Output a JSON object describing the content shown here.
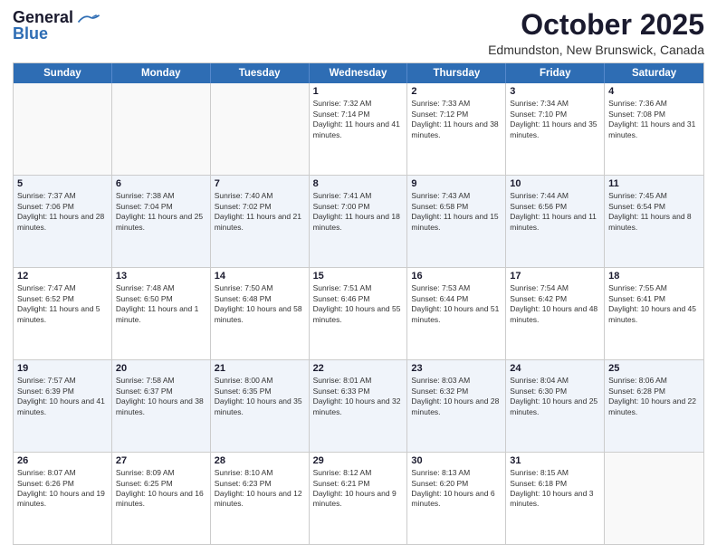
{
  "header": {
    "logo_line1": "General",
    "logo_line2": "Blue",
    "month": "October 2025",
    "location": "Edmundston, New Brunswick, Canada"
  },
  "days_of_week": [
    "Sunday",
    "Monday",
    "Tuesday",
    "Wednesday",
    "Thursday",
    "Friday",
    "Saturday"
  ],
  "weeks": [
    [
      {
        "day": "",
        "sunrise": "",
        "sunset": "",
        "daylight": ""
      },
      {
        "day": "",
        "sunrise": "",
        "sunset": "",
        "daylight": ""
      },
      {
        "day": "",
        "sunrise": "",
        "sunset": "",
        "daylight": ""
      },
      {
        "day": "1",
        "sunrise": "Sunrise: 7:32 AM",
        "sunset": "Sunset: 7:14 PM",
        "daylight": "Daylight: 11 hours and 41 minutes."
      },
      {
        "day": "2",
        "sunrise": "Sunrise: 7:33 AM",
        "sunset": "Sunset: 7:12 PM",
        "daylight": "Daylight: 11 hours and 38 minutes."
      },
      {
        "day": "3",
        "sunrise": "Sunrise: 7:34 AM",
        "sunset": "Sunset: 7:10 PM",
        "daylight": "Daylight: 11 hours and 35 minutes."
      },
      {
        "day": "4",
        "sunrise": "Sunrise: 7:36 AM",
        "sunset": "Sunset: 7:08 PM",
        "daylight": "Daylight: 11 hours and 31 minutes."
      }
    ],
    [
      {
        "day": "5",
        "sunrise": "Sunrise: 7:37 AM",
        "sunset": "Sunset: 7:06 PM",
        "daylight": "Daylight: 11 hours and 28 minutes."
      },
      {
        "day": "6",
        "sunrise": "Sunrise: 7:38 AM",
        "sunset": "Sunset: 7:04 PM",
        "daylight": "Daylight: 11 hours and 25 minutes."
      },
      {
        "day": "7",
        "sunrise": "Sunrise: 7:40 AM",
        "sunset": "Sunset: 7:02 PM",
        "daylight": "Daylight: 11 hours and 21 minutes."
      },
      {
        "day": "8",
        "sunrise": "Sunrise: 7:41 AM",
        "sunset": "Sunset: 7:00 PM",
        "daylight": "Daylight: 11 hours and 18 minutes."
      },
      {
        "day": "9",
        "sunrise": "Sunrise: 7:43 AM",
        "sunset": "Sunset: 6:58 PM",
        "daylight": "Daylight: 11 hours and 15 minutes."
      },
      {
        "day": "10",
        "sunrise": "Sunrise: 7:44 AM",
        "sunset": "Sunset: 6:56 PM",
        "daylight": "Daylight: 11 hours and 11 minutes."
      },
      {
        "day": "11",
        "sunrise": "Sunrise: 7:45 AM",
        "sunset": "Sunset: 6:54 PM",
        "daylight": "Daylight: 11 hours and 8 minutes."
      }
    ],
    [
      {
        "day": "12",
        "sunrise": "Sunrise: 7:47 AM",
        "sunset": "Sunset: 6:52 PM",
        "daylight": "Daylight: 11 hours and 5 minutes."
      },
      {
        "day": "13",
        "sunrise": "Sunrise: 7:48 AM",
        "sunset": "Sunset: 6:50 PM",
        "daylight": "Daylight: 11 hours and 1 minute."
      },
      {
        "day": "14",
        "sunrise": "Sunrise: 7:50 AM",
        "sunset": "Sunset: 6:48 PM",
        "daylight": "Daylight: 10 hours and 58 minutes."
      },
      {
        "day": "15",
        "sunrise": "Sunrise: 7:51 AM",
        "sunset": "Sunset: 6:46 PM",
        "daylight": "Daylight: 10 hours and 55 minutes."
      },
      {
        "day": "16",
        "sunrise": "Sunrise: 7:53 AM",
        "sunset": "Sunset: 6:44 PM",
        "daylight": "Daylight: 10 hours and 51 minutes."
      },
      {
        "day": "17",
        "sunrise": "Sunrise: 7:54 AM",
        "sunset": "Sunset: 6:42 PM",
        "daylight": "Daylight: 10 hours and 48 minutes."
      },
      {
        "day": "18",
        "sunrise": "Sunrise: 7:55 AM",
        "sunset": "Sunset: 6:41 PM",
        "daylight": "Daylight: 10 hours and 45 minutes."
      }
    ],
    [
      {
        "day": "19",
        "sunrise": "Sunrise: 7:57 AM",
        "sunset": "Sunset: 6:39 PM",
        "daylight": "Daylight: 10 hours and 41 minutes."
      },
      {
        "day": "20",
        "sunrise": "Sunrise: 7:58 AM",
        "sunset": "Sunset: 6:37 PM",
        "daylight": "Daylight: 10 hours and 38 minutes."
      },
      {
        "day": "21",
        "sunrise": "Sunrise: 8:00 AM",
        "sunset": "Sunset: 6:35 PM",
        "daylight": "Daylight: 10 hours and 35 minutes."
      },
      {
        "day": "22",
        "sunrise": "Sunrise: 8:01 AM",
        "sunset": "Sunset: 6:33 PM",
        "daylight": "Daylight: 10 hours and 32 minutes."
      },
      {
        "day": "23",
        "sunrise": "Sunrise: 8:03 AM",
        "sunset": "Sunset: 6:32 PM",
        "daylight": "Daylight: 10 hours and 28 minutes."
      },
      {
        "day": "24",
        "sunrise": "Sunrise: 8:04 AM",
        "sunset": "Sunset: 6:30 PM",
        "daylight": "Daylight: 10 hours and 25 minutes."
      },
      {
        "day": "25",
        "sunrise": "Sunrise: 8:06 AM",
        "sunset": "Sunset: 6:28 PM",
        "daylight": "Daylight: 10 hours and 22 minutes."
      }
    ],
    [
      {
        "day": "26",
        "sunrise": "Sunrise: 8:07 AM",
        "sunset": "Sunset: 6:26 PM",
        "daylight": "Daylight: 10 hours and 19 minutes."
      },
      {
        "day": "27",
        "sunrise": "Sunrise: 8:09 AM",
        "sunset": "Sunset: 6:25 PM",
        "daylight": "Daylight: 10 hours and 16 minutes."
      },
      {
        "day": "28",
        "sunrise": "Sunrise: 8:10 AM",
        "sunset": "Sunset: 6:23 PM",
        "daylight": "Daylight: 10 hours and 12 minutes."
      },
      {
        "day": "29",
        "sunrise": "Sunrise: 8:12 AM",
        "sunset": "Sunset: 6:21 PM",
        "daylight": "Daylight: 10 hours and 9 minutes."
      },
      {
        "day": "30",
        "sunrise": "Sunrise: 8:13 AM",
        "sunset": "Sunset: 6:20 PM",
        "daylight": "Daylight: 10 hours and 6 minutes."
      },
      {
        "day": "31",
        "sunrise": "Sunrise: 8:15 AM",
        "sunset": "Sunset: 6:18 PM",
        "daylight": "Daylight: 10 hours and 3 minutes."
      },
      {
        "day": "",
        "sunrise": "",
        "sunset": "",
        "daylight": ""
      }
    ]
  ]
}
